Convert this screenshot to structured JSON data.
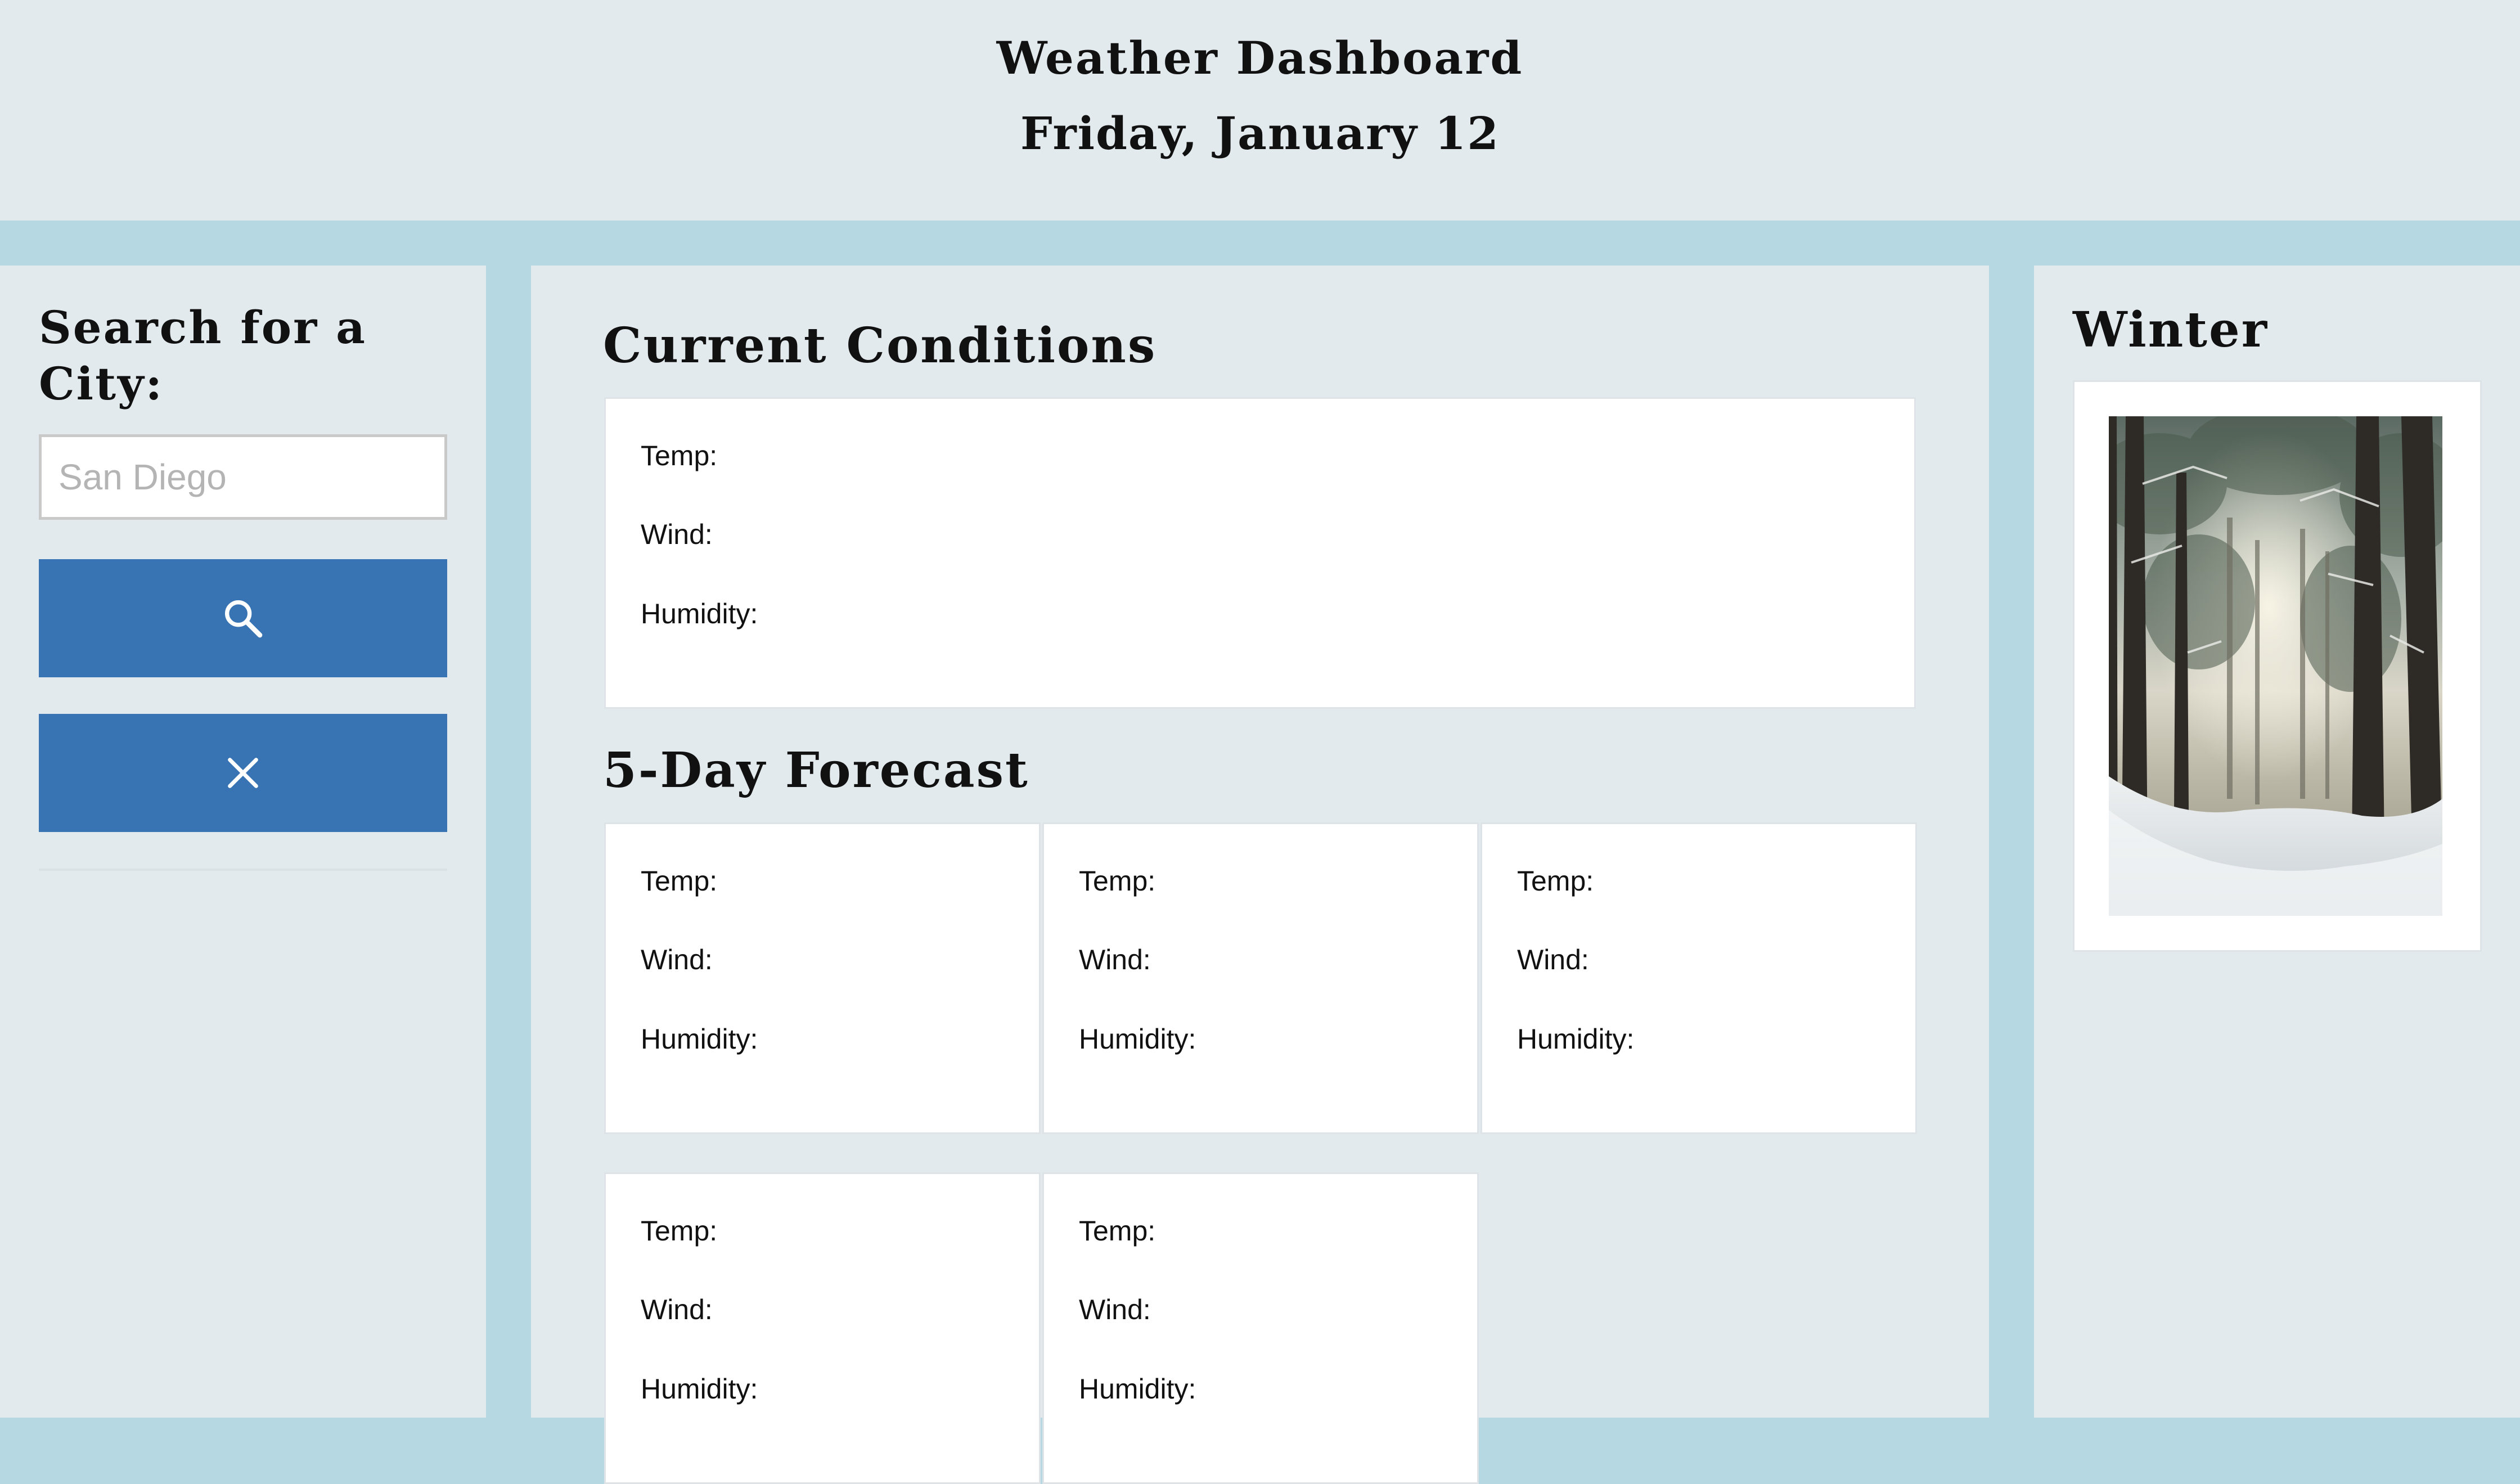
{
  "header": {
    "title": "Weather Dashboard",
    "date": "Friday, January 12"
  },
  "sidebar": {
    "heading": "Search for a City:",
    "search_placeholder": "San Diego",
    "search_icon": "search-icon",
    "clear_icon": "close-icon"
  },
  "current": {
    "heading": "Current Conditions",
    "temp_label": "Temp:",
    "wind_label": "Wind:",
    "humidity_label": "Humidity:"
  },
  "forecast": {
    "heading": "5-Day Forecast",
    "days": [
      {
        "temp_label": "Temp:",
        "wind_label": "Wind:",
        "humidity_label": "Humidity:"
      },
      {
        "temp_label": "Temp:",
        "wind_label": "Wind:",
        "humidity_label": "Humidity:"
      },
      {
        "temp_label": "Temp:",
        "wind_label": "Wind:",
        "humidity_label": "Humidity:"
      },
      {
        "temp_label": "Temp:",
        "wind_label": "Wind:",
        "humidity_label": "Humidity:"
      },
      {
        "temp_label": "Temp:",
        "wind_label": "Wind:",
        "humidity_label": "Humidity:"
      }
    ]
  },
  "season": {
    "heading": "Winter",
    "image": "snowy-forest-photo"
  },
  "colors": {
    "page_background": "#b6d8e3",
    "panel_background": "#e3eaee",
    "button_blue": "#3874b3",
    "card_background": "#ffffff"
  }
}
